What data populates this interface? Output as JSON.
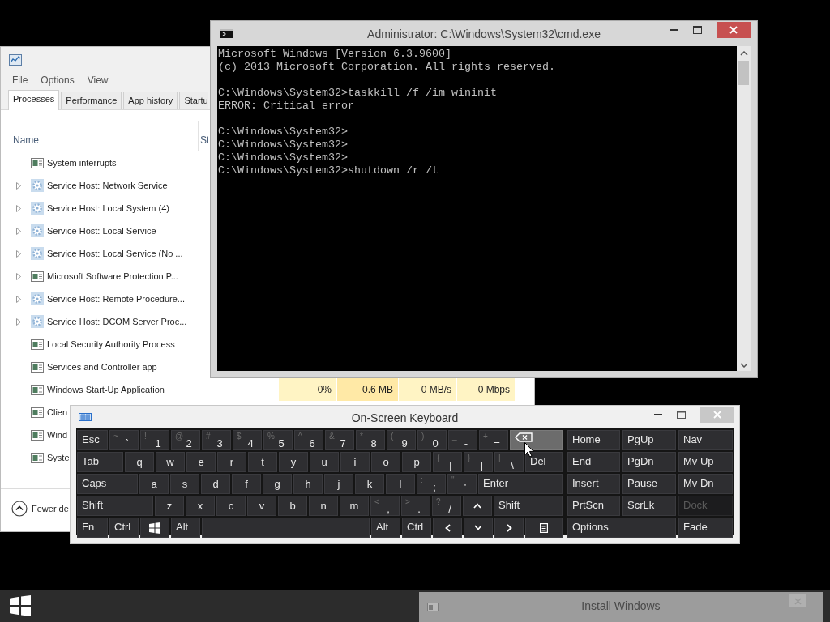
{
  "task_manager": {
    "menu": [
      "File",
      "Options",
      "View"
    ],
    "tabs": [
      {
        "label": "Processes",
        "selected": true
      },
      {
        "label": "Performance",
        "selected": false
      },
      {
        "label": "App history",
        "selected": false
      },
      {
        "label": "Startu",
        "selected": false
      }
    ],
    "columns": [
      "Name",
      "St"
    ],
    "processes": [
      {
        "name": "System interrupts",
        "kind": "app",
        "expandable": false
      },
      {
        "name": "Service Host: Network Service",
        "kind": "service",
        "expandable": true
      },
      {
        "name": "Service Host: Local System (4)",
        "kind": "service",
        "expandable": true
      },
      {
        "name": "Service Host: Local Service",
        "kind": "service",
        "expandable": true
      },
      {
        "name": "Service Host: Local Service (No ...",
        "kind": "service",
        "expandable": true
      },
      {
        "name": "Microsoft Software Protection P...",
        "kind": "app",
        "expandable": true
      },
      {
        "name": "Service Host: Remote Procedure...",
        "kind": "service",
        "expandable": true
      },
      {
        "name": "Service Host: DCOM Server Proc...",
        "kind": "service",
        "expandable": true
      },
      {
        "name": "Local Security Authority Process",
        "kind": "app",
        "expandable": false
      },
      {
        "name": "Services and Controller app",
        "kind": "app",
        "expandable": false
      },
      {
        "name": "Windows Start-Up Application",
        "kind": "app",
        "expandable": false,
        "values": [
          "0%",
          "0.6 MB",
          "0 MB/s",
          "0 Mbps"
        ]
      },
      {
        "name": "Clien",
        "kind": "app",
        "expandable": false
      },
      {
        "name": "Wind",
        "kind": "app",
        "expandable": false
      },
      {
        "name": "Syste",
        "kind": "app",
        "expandable": false
      }
    ],
    "footer_link": "Fewer de"
  },
  "cmd": {
    "title": "Administrator: C:\\Windows\\System32\\cmd.exe",
    "output": "Microsoft Windows [Version 6.3.9600]\n(c) 2013 Microsoft Corporation. All rights reserved.\n\nC:\\Windows\\System32>taskkill /f /im wininit\nERROR: Critical error\n\nC:\\Windows\\System32>\nC:\\Windows\\System32>\nC:\\Windows\\System32>\nC:\\Windows\\System32>shutdown /r /t"
  },
  "keyboard": {
    "title": "On-Screen Keyboard",
    "main_rows": [
      [
        {
          "kind": "label",
          "label": "Esc",
          "hovered": false,
          "disabled": false
        },
        {
          "kind": "char",
          "shift": "~",
          "label": "`",
          "hovered": false,
          "disabled": false
        },
        {
          "kind": "char",
          "shift": "!",
          "label": "1",
          "hovered": false,
          "disabled": false
        },
        {
          "kind": "char",
          "shift": "@",
          "label": "2",
          "hovered": false,
          "disabled": false
        },
        {
          "kind": "char",
          "shift": "#",
          "label": "3",
          "hovered": false,
          "disabled": false
        },
        {
          "kind": "char",
          "shift": "$",
          "label": "4",
          "hovered": false,
          "disabled": false
        },
        {
          "kind": "char",
          "shift": "%",
          "label": "5",
          "hovered": false,
          "disabled": false
        },
        {
          "kind": "char",
          "shift": "^",
          "label": "6",
          "hovered": false,
          "disabled": false
        },
        {
          "kind": "char",
          "shift": "&",
          "label": "7",
          "hovered": false,
          "disabled": false
        },
        {
          "kind": "char",
          "shift": "*",
          "label": "8",
          "hovered": false,
          "disabled": false
        },
        {
          "kind": "char",
          "shift": "(",
          "label": "9",
          "hovered": false,
          "disabled": false
        },
        {
          "kind": "char",
          "shift": ")",
          "label": "0",
          "hovered": false,
          "disabled": false
        },
        {
          "kind": "char",
          "shift": "_",
          "label": "-",
          "hovered": false,
          "disabled": false
        },
        {
          "kind": "char",
          "shift": "+",
          "label": "=",
          "hovered": false,
          "disabled": false
        },
        {
          "kind": "backspace",
          "hovered": true,
          "disabled": false
        }
      ],
      [
        {
          "kind": "label",
          "label": "Tab",
          "hovered": false,
          "disabled": false
        },
        {
          "kind": "char",
          "label": "q",
          "hovered": false,
          "disabled": false
        },
        {
          "kind": "char",
          "label": "w",
          "hovered": false,
          "disabled": false
        },
        {
          "kind": "char",
          "label": "e",
          "hovered": false,
          "disabled": false
        },
        {
          "kind": "char",
          "label": "r",
          "hovered": false,
          "disabled": false
        },
        {
          "kind": "char",
          "label": "t",
          "hovered": false,
          "disabled": false
        },
        {
          "kind": "char",
          "label": "y",
          "hovered": false,
          "disabled": false
        },
        {
          "kind": "char",
          "label": "u",
          "hovered": false,
          "disabled": false
        },
        {
          "kind": "char",
          "label": "i",
          "hovered": false,
          "disabled": false
        },
        {
          "kind": "char",
          "label": "o",
          "hovered": false,
          "disabled": false
        },
        {
          "kind": "char",
          "label": "p",
          "hovered": false,
          "disabled": false
        },
        {
          "kind": "char",
          "shift": "{",
          "label": "[",
          "hovered": false,
          "disabled": false
        },
        {
          "kind": "char",
          "shift": "}",
          "label": "]",
          "hovered": false,
          "disabled": false
        },
        {
          "kind": "char",
          "shift": "|",
          "label": "\\",
          "hovered": false,
          "disabled": false
        },
        {
          "kind": "label",
          "label": "Del",
          "hovered": false,
          "disabled": false
        }
      ],
      [
        {
          "kind": "label",
          "label": "Caps",
          "hovered": false,
          "disabled": false
        },
        {
          "kind": "char",
          "label": "a",
          "hovered": false,
          "disabled": false
        },
        {
          "kind": "char",
          "label": "s",
          "hovered": false,
          "disabled": false
        },
        {
          "kind": "char",
          "label": "d",
          "hovered": false,
          "disabled": false
        },
        {
          "kind": "char",
          "label": "f",
          "hovered": false,
          "disabled": false
        },
        {
          "kind": "char",
          "label": "g",
          "hovered": false,
          "disabled": false
        },
        {
          "kind": "char",
          "label": "h",
          "hovered": false,
          "disabled": false
        },
        {
          "kind": "char",
          "label": "j",
          "hovered": false,
          "disabled": false
        },
        {
          "kind": "char",
          "label": "k",
          "hovered": false,
          "disabled": false
        },
        {
          "kind": "char",
          "label": "l",
          "hovered": false,
          "disabled": false
        },
        {
          "kind": "char",
          "shift": ":",
          "label": ";",
          "hovered": false,
          "disabled": false
        },
        {
          "kind": "char",
          "shift": "\"",
          "label": "'",
          "hovered": false,
          "disabled": false
        },
        {
          "kind": "label",
          "label": "Enter",
          "hovered": false,
          "disabled": false
        }
      ],
      [
        {
          "kind": "label",
          "label": "Shift",
          "hovered": false,
          "disabled": false
        },
        {
          "kind": "char",
          "label": "z",
          "hovered": false,
          "disabled": false
        },
        {
          "kind": "char",
          "label": "x",
          "hovered": false,
          "disabled": false
        },
        {
          "kind": "char",
          "label": "c",
          "hovered": false,
          "disabled": false
        },
        {
          "kind": "char",
          "label": "v",
          "hovered": false,
          "disabled": false
        },
        {
          "kind": "char",
          "label": "b",
          "hovered": false,
          "disabled": false
        },
        {
          "kind": "char",
          "label": "n",
          "hovered": false,
          "disabled": false
        },
        {
          "kind": "char",
          "label": "m",
          "hovered": false,
          "disabled": false
        },
        {
          "kind": "char",
          "shift": "<",
          "label": ",",
          "hovered": false,
          "disabled": false
        },
        {
          "kind": "char",
          "shift": ">",
          "label": ".",
          "hovered": false,
          "disabled": false
        },
        {
          "kind": "char",
          "shift": "?",
          "label": "/",
          "hovered": false,
          "disabled": false
        },
        {
          "kind": "up",
          "hovered": false,
          "disabled": false
        },
        {
          "kind": "label",
          "label": "Shift",
          "hovered": false,
          "disabled": false
        }
      ],
      [
        {
          "kind": "label",
          "label": "Fn",
          "hovered": false,
          "disabled": false
        },
        {
          "kind": "label",
          "label": "Ctrl",
          "hovered": false,
          "disabled": false
        },
        {
          "kind": "windows",
          "hovered": false,
          "disabled": false
        },
        {
          "kind": "label",
          "label": "Alt",
          "hovered": false,
          "disabled": false
        },
        {
          "kind": "space",
          "hovered": false,
          "disabled": false
        },
        {
          "kind": "label",
          "label": "Alt",
          "hovered": false,
          "disabled": false
        },
        {
          "kind": "label",
          "label": "Ctrl",
          "hovered": false,
          "disabled": false
        },
        {
          "kind": "left",
          "hovered": false,
          "disabled": false
        },
        {
          "kind": "down",
          "hovered": false,
          "disabled": false
        },
        {
          "kind": "right",
          "hovered": false,
          "disabled": false
        },
        {
          "kind": "menu",
          "hovered": false,
          "disabled": false
        }
      ]
    ],
    "nav_rows": [
      [
        {
          "kind": "label",
          "label": "Home",
          "hovered": false,
          "disabled": false
        },
        {
          "kind": "label",
          "label": "PgUp",
          "hovered": false,
          "disabled": false
        },
        {
          "kind": "label",
          "label": "Nav",
          "hovered": false,
          "disabled": false
        }
      ],
      [
        {
          "kind": "label",
          "label": "End",
          "hovered": false,
          "disabled": false
        },
        {
          "kind": "label",
          "label": "PgDn",
          "hovered": false,
          "disabled": false
        },
        {
          "kind": "label",
          "label": "Mv Up",
          "hovered": false,
          "disabled": false
        }
      ],
      [
        {
          "kind": "label",
          "label": "Insert",
          "hovered": false,
          "disabled": false
        },
        {
          "kind": "label",
          "label": "Pause",
          "hovered": false,
          "disabled": false
        },
        {
          "kind": "label",
          "label": "Mv Dn",
          "hovered": false,
          "disabled": false
        }
      ],
      [
        {
          "kind": "label",
          "label": "PrtScn",
          "hovered": false,
          "disabled": false
        },
        {
          "kind": "label",
          "label": "ScrLk",
          "hovered": false,
          "disabled": false
        },
        {
          "kind": "label",
          "label": "Dock",
          "hovered": false,
          "disabled": true
        }
      ],
      [
        {
          "kind": "label",
          "label": "Options",
          "hovered": false,
          "disabled": false
        },
        {
          "kind": "label",
          "label": "Fade",
          "hovered": false,
          "disabled": false
        }
      ]
    ]
  },
  "taskbar": {
    "windows": [
      {
        "title": "Install Windows"
      }
    ]
  }
}
